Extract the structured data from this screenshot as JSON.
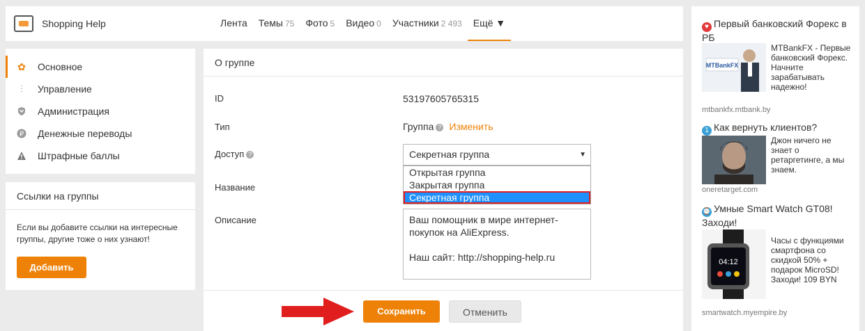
{
  "header": {
    "group_name": "Shopping Help",
    "nav": [
      {
        "label": "Лента",
        "count": ""
      },
      {
        "label": "Темы",
        "count": "75"
      },
      {
        "label": "Фото",
        "count": "5"
      },
      {
        "label": "Видео",
        "count": "0"
      },
      {
        "label": "Участники",
        "count": "2 493"
      },
      {
        "label": "Ещё ▼",
        "count": ""
      }
    ]
  },
  "sidebar": {
    "items": [
      {
        "label": "Основное",
        "icon": "gear-icon"
      },
      {
        "label": "Управление",
        "icon": "sliders-icon"
      },
      {
        "label": "Администрация",
        "icon": "shield-icon"
      },
      {
        "label": "Денежные переводы",
        "icon": "ruble-icon"
      },
      {
        "label": "Штрафные баллы",
        "icon": "warning-icon"
      }
    ],
    "links_box": {
      "title": "Ссылки на группы",
      "text": "Если вы добавите ссылки на интересные группы, другие тоже о них узнают!",
      "button": "Добавить"
    }
  },
  "main": {
    "title": "О группе",
    "id_label": "ID",
    "id_value": "53197605765315",
    "type_label": "Тип",
    "type_value": "Группа",
    "change_link": "Изменить",
    "access_label": "Доступ",
    "access_selected": "Секретная группа",
    "access_options": [
      "Открытая группа",
      "Закрытая группа",
      "Секретная группа"
    ],
    "name_label": "Название",
    "desc_label": "Описание",
    "desc_value": "Ваш помощник в мире интернет-покупок на AliExpress.\n\nНаш сайт: http://shopping-help.ru",
    "save_button": "Сохранить",
    "cancel_button": "Отменить"
  },
  "ads": [
    {
      "title": "Первый банковский Форекс в РБ",
      "text": "MTBankFX - Первые банковский Форекс. Начните зарабатывать надежно!",
      "domain": "mtbankfx.mtbank.by"
    },
    {
      "title": "Как вернуть клиентов?",
      "text": "Джон ничего не знает о ретаргетинге, а мы знаем.",
      "domain": "oneretarget.com"
    },
    {
      "title": "Умные Smart Watch GT08! Заходи!",
      "text": "Часы с функциями смартфона со скидкой 50% + подарок MicroSD! Заходи! 109 BYN",
      "domain": "smartwatch.myempire.by"
    }
  ],
  "colors": {
    "accent": "#ee8208",
    "selected_option": "#1e90ff",
    "highlight_red": "#e01e1e"
  }
}
